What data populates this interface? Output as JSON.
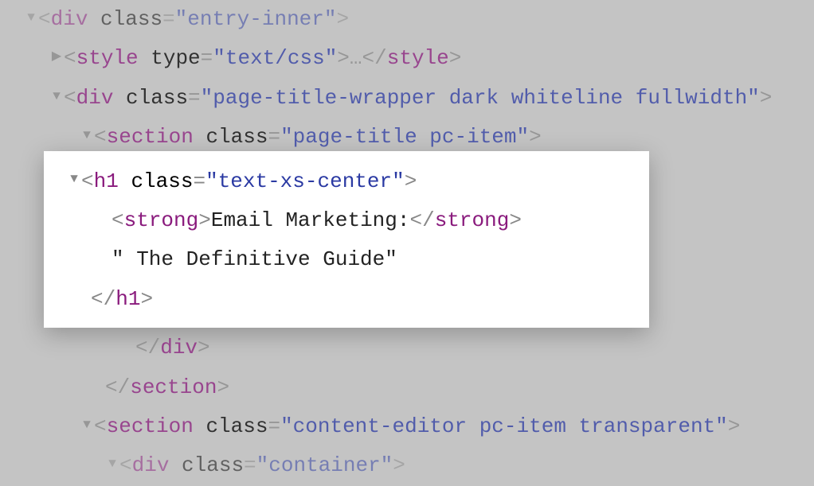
{
  "triangles": {
    "down": "▼",
    "right": "▶"
  },
  "lines": {
    "l1": {
      "tag": "div",
      "attr": "class",
      "val": "\"entry-inner\"",
      "triangle": "down"
    },
    "l2": {
      "tag": "style",
      "attr": "type",
      "val": "\"text/css\"",
      "ellipsis": "…",
      "closeTag": "style",
      "triangle": "right"
    },
    "l3": {
      "tag": "div",
      "attr": "class",
      "val": "\"page-title-wrapper dark whiteline fullwidth\"",
      "triangle": "down"
    },
    "l4": {
      "tag": "section",
      "attr": "class",
      "val": "\"page-title pc-item\"",
      "triangle": "down"
    },
    "l5": {
      "tag": "h1",
      "attr": "class",
      "val": "\"text-xs-center\"",
      "triangle": "down"
    },
    "l6": {
      "tag": "strong",
      "text": "Email Marketing:",
      "closeTag": "strong"
    },
    "l7": {
      "text": "\" The Definitive Guide\""
    },
    "l8": {
      "closeTag": "h1"
    },
    "l9": {
      "closeTag": "div"
    },
    "l10": {
      "closeTag": "section"
    },
    "l11": {
      "tag": "section",
      "attr": "class",
      "val": "\"content-editor pc-item transparent\"",
      "triangle": "down"
    },
    "l12": {
      "tag": "div",
      "attr": "class",
      "val": "\"container\"",
      "triangle": "down"
    }
  }
}
